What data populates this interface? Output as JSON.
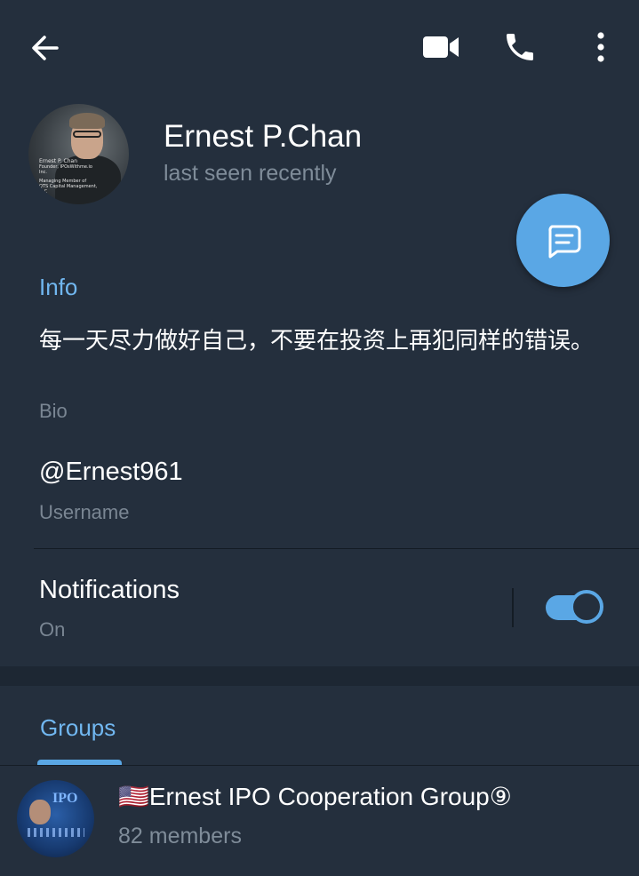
{
  "colors": {
    "background": "#1d2733",
    "surface": "#242f3d",
    "accent": "#5aa7e5",
    "section_title": "#71b7f0",
    "secondary_text": "#7f8c99"
  },
  "header": {
    "back_icon": "arrow-left-icon",
    "video_call_icon": "video-camera-icon",
    "voice_call_icon": "phone-icon",
    "menu_icon": "more-vertical-icon"
  },
  "profile": {
    "name": "Ernest P.Chan",
    "status": "last seen recently",
    "avatar_caption_name": "Ernest P. Chan",
    "avatar_caption_line1": "Founder, IPOsWithme.io Inc.",
    "avatar_caption_line2": "Managing Member of",
    "avatar_caption_line3": "QTS Capital Management, LLC"
  },
  "fab": {
    "icon": "message-icon"
  },
  "info": {
    "title": "Info",
    "bio": "每一天尽力做好自己，不要在投资上再犯同样的错误。",
    "bio_label": "Bio",
    "username": "@Ernest961",
    "username_label": "Username",
    "notifications_label": "Notifications",
    "notifications_value": "On",
    "notifications_enabled": true
  },
  "groups": {
    "tab_label": "Groups",
    "items": [
      {
        "name": "🇺🇸Ernest IPO Cooperation Group⑨",
        "members": "82 members",
        "avatar_text": "IPO"
      }
    ]
  }
}
